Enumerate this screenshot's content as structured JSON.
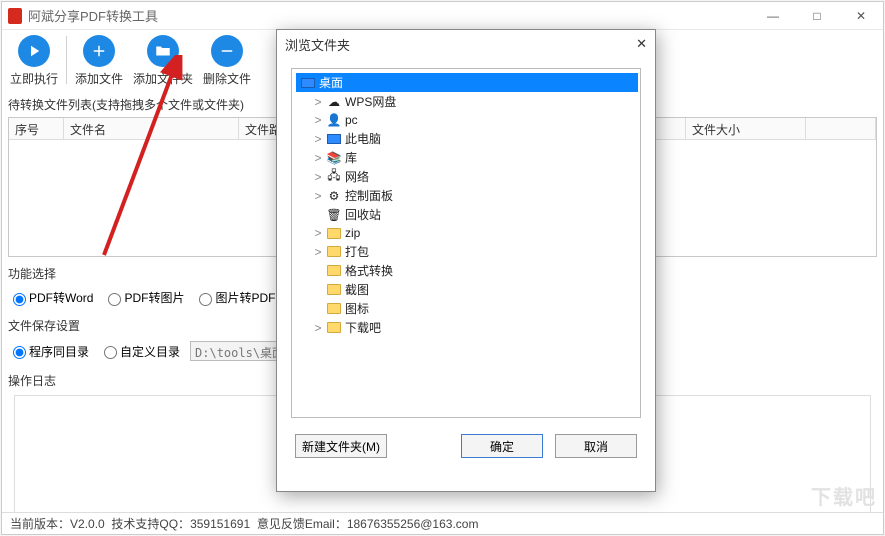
{
  "window": {
    "title": "阿斌分享PDF转换工具",
    "min": "—",
    "max": "□",
    "close": "✕"
  },
  "toolbar": {
    "run": "立即执行",
    "addfile": "添加文件",
    "addfolder": "添加文件夹",
    "delfile": "删除文件"
  },
  "list": {
    "caption": "待转换文件列表(支持拖拽多个文件或文件夹)",
    "cols": {
      "no": "序号",
      "name": "文件名",
      "path": "文件路径",
      "size": "文件大小"
    }
  },
  "func": {
    "caption": "功能选择",
    "pdf2word": "PDF转Word",
    "pdf2img": "PDF转图片",
    "img2pdf": "图片转PDF"
  },
  "save": {
    "caption": "文件保存设置",
    "same": "程序同目录",
    "custom": "自定义目录",
    "path": "D:\\tools\\桌面"
  },
  "log": {
    "caption": "操作日志"
  },
  "status": {
    "version_label": "当前版本：",
    "version": "V2.0.0",
    "qq_label": "技术支持QQ：",
    "qq": "359151691",
    "email_label": "意见反馈Email：",
    "email": "18676355256@163.com"
  },
  "dialog": {
    "title": "浏览文件夹",
    "close": "✕",
    "tree": {
      "root": "桌面",
      "items": [
        {
          "label": "WPS网盘",
          "icon": "cloud",
          "expand": ">"
        },
        {
          "label": "pc",
          "icon": "user",
          "expand": ">"
        },
        {
          "label": "此电脑",
          "icon": "monitor",
          "expand": ">"
        },
        {
          "label": "库",
          "icon": "lib",
          "expand": ">"
        },
        {
          "label": "网络",
          "icon": "net",
          "expand": ">"
        },
        {
          "label": "控制面板",
          "icon": "panel",
          "expand": ">"
        },
        {
          "label": "回收站",
          "icon": "trash",
          "expand": ""
        },
        {
          "label": "zip",
          "icon": "folder",
          "expand": ">"
        },
        {
          "label": "打包",
          "icon": "folder",
          "expand": ">"
        },
        {
          "label": "格式转换",
          "icon": "folder",
          "expand": ""
        },
        {
          "label": "截图",
          "icon": "folder",
          "expand": ""
        },
        {
          "label": "图标",
          "icon": "folder",
          "expand": ""
        },
        {
          "label": "下载吧",
          "icon": "folder",
          "expand": ">"
        }
      ]
    },
    "btn_new": "新建文件夹(M)",
    "btn_ok": "确定",
    "btn_cancel": "取消"
  },
  "watermark": "下载吧"
}
